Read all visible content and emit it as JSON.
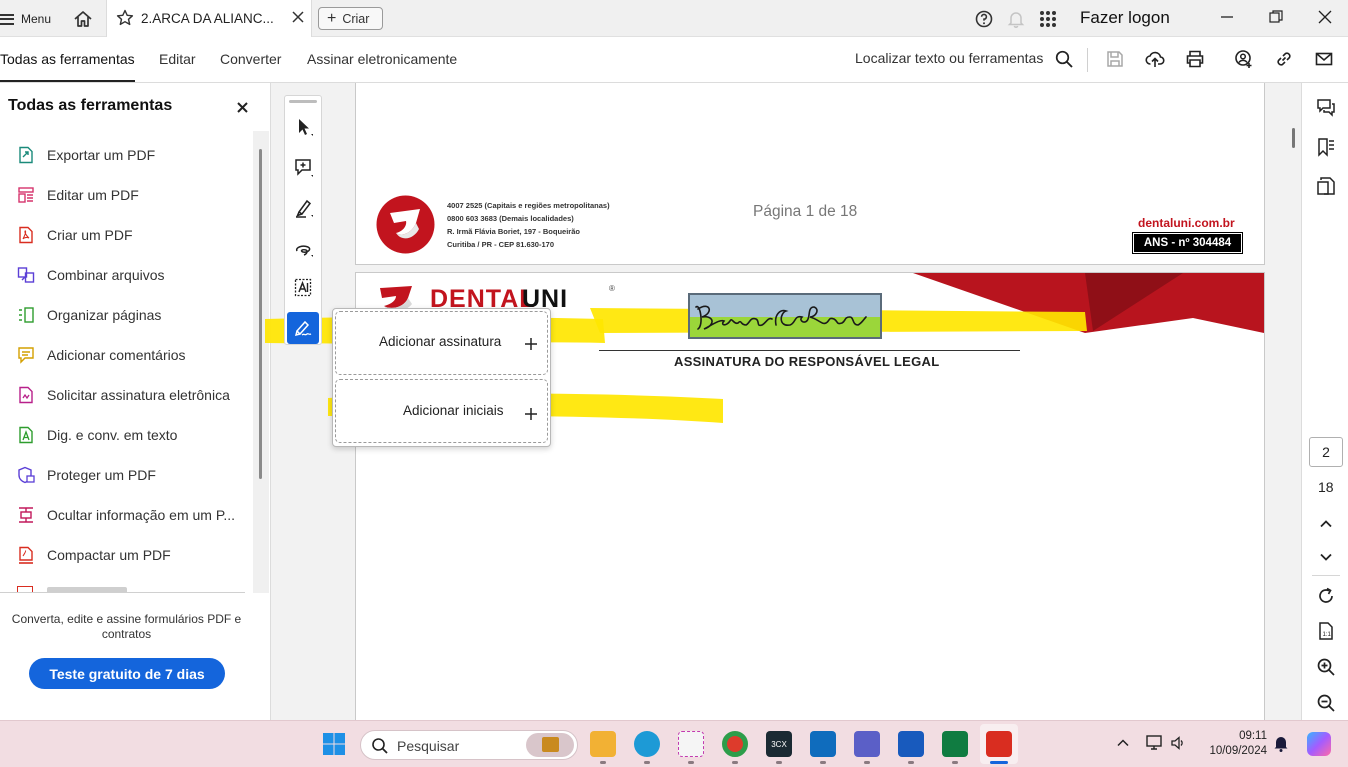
{
  "titlebar": {
    "menu_label": "Menu",
    "tab_title": "2.ARCA DA ALIANC...",
    "new_label": "Criar",
    "login_label": "Fazer logon"
  },
  "toolbar": {
    "tabs": [
      "Todas as ferramentas",
      "Editar",
      "Converter",
      "Assinar eletronicamente"
    ],
    "find_label": "Localizar texto ou ferramentas"
  },
  "leftpanel": {
    "title": "Todas as ferramentas",
    "items": [
      {
        "label": "Exportar um PDF",
        "icon": "export-pdf-icon",
        "color": "#1a8a7a"
      },
      {
        "label": "Editar um PDF",
        "icon": "edit-pdf-icon",
        "color": "#d6336c"
      },
      {
        "label": "Criar um PDF",
        "icon": "create-pdf-icon",
        "color": "#d92d20"
      },
      {
        "label": "Combinar arquivos",
        "icon": "combine-files-icon",
        "color": "#5b3fd6"
      },
      {
        "label": "Organizar páginas",
        "icon": "organize-pages-icon",
        "color": "#2e9d2e"
      },
      {
        "label": "Adicionar comentários",
        "icon": "add-comments-icon",
        "color": "#d4a000"
      },
      {
        "label": "Solicitar assinatura eletrônica",
        "icon": "request-signature-icon",
        "color": "#b8208a"
      },
      {
        "label": "Dig. e conv. em texto",
        "icon": "scan-ocr-icon",
        "color": "#2e9d2e"
      },
      {
        "label": "Proteger um PDF",
        "icon": "protect-pdf-icon",
        "color": "#5b3fd6"
      },
      {
        "label": "Ocultar informação em um P...",
        "icon": "redact-icon",
        "color": "#c2185b"
      },
      {
        "label": "Compactar um PDF",
        "icon": "compress-pdf-icon",
        "color": "#d92d20"
      }
    ],
    "promo_text": "Converta, edite e assine formulários PDF e contratos",
    "trial_label": "Teste gratuito de 7 dias"
  },
  "document": {
    "contact_lines": [
      "4007 2525 (Capitais e regiões metropolitanas)",
      "0800 603 3683 (Demais localidades)",
      "R. Irmã Flávia Boriet, 197 - Boqueirão",
      "Curitiba / PR - CEP 81.630-170"
    ],
    "page_label": "Página 1 de 18",
    "site": "dentaluni.com.br",
    "ans": "ANS - nº 304484",
    "brand_part1": "DENTAL",
    "brand_part2": "UNI",
    "brand_reg": "®",
    "signature_caption": "ASSINATURA DO RESPONSÁVEL LEGAL",
    "brand_color": "#c2141e",
    "highlight_color": "#ffe600"
  },
  "sign_popup": {
    "add_signature": "Adicionar assinatura",
    "add_initials": "Adicionar iniciais"
  },
  "pager": {
    "current": "2",
    "total": "18"
  },
  "taskbar": {
    "search_placeholder": "Pesquisar",
    "time": "09:11",
    "date": "10/09/2024"
  }
}
